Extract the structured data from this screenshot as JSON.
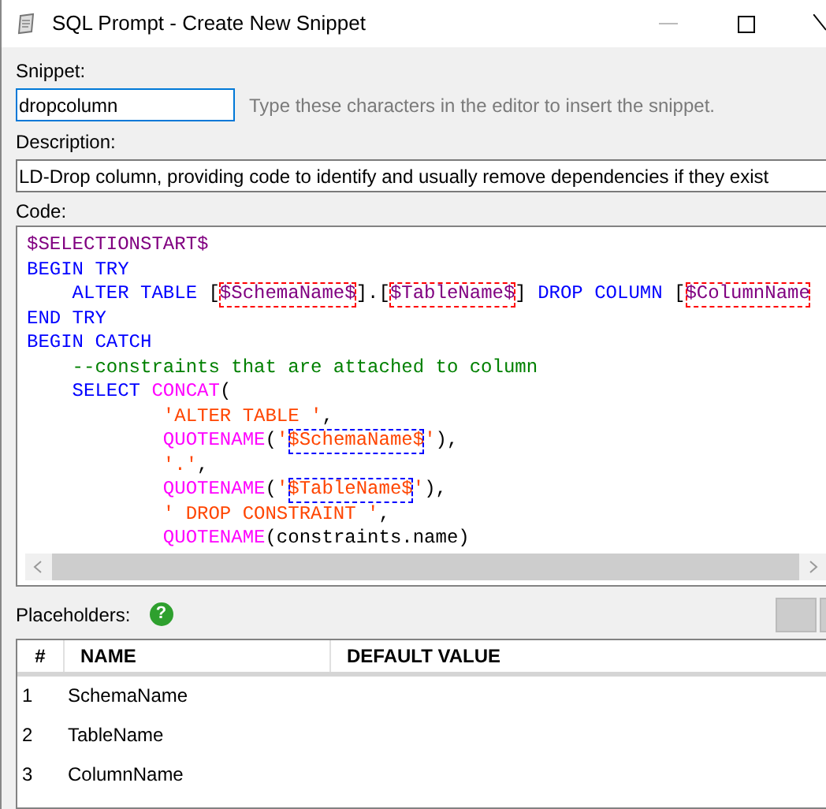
{
  "window": {
    "title": "SQL Prompt - Create New Snippet"
  },
  "snippet": {
    "label": "Snippet:",
    "value": "dropcolumn",
    "focused": true,
    "hint": "Type these characters in the editor to insert the snippet."
  },
  "description": {
    "label": "Description:",
    "value": "LD-Drop column, providing code to identify and usually remove dependencies if they exist"
  },
  "code": {
    "label": "Code:",
    "lines": [
      [
        {
          "kind": "variable",
          "text": "$SELECTIONSTART$"
        }
      ],
      [
        {
          "kind": "keyword",
          "text": "BEGIN TRY"
        }
      ],
      [
        {
          "kind": "keyword",
          "text": "    ALTER TABLE "
        },
        {
          "kind": "plain",
          "text": "["
        },
        {
          "kind": "placeholder",
          "text": "$SchemaName$"
        },
        {
          "kind": "plain",
          "text": "].["
        },
        {
          "kind": "placeholder",
          "text": "$TableName$"
        },
        {
          "kind": "plain",
          "text": "] "
        },
        {
          "kind": "keyword",
          "text": "DROP COLUMN "
        },
        {
          "kind": "plain",
          "text": "["
        },
        {
          "kind": "placeholder",
          "text": "$ColumnName"
        }
      ],
      [
        {
          "kind": "keyword",
          "text": "END TRY"
        }
      ],
      [
        {
          "kind": "keyword",
          "text": "BEGIN CATCH"
        }
      ],
      [
        {
          "kind": "comment",
          "text": "    --constraints that are attached to column"
        }
      ],
      [
        {
          "kind": "keyword",
          "text": "    SELECT "
        },
        {
          "kind": "function",
          "text": "CONCAT"
        },
        {
          "kind": "plain",
          "text": "("
        }
      ],
      [
        {
          "kind": "string",
          "text": "            'ALTER TABLE '"
        },
        {
          "kind": "plain",
          "text": ","
        }
      ],
      [
        {
          "kind": "function",
          "text": "            QUOTENAME"
        },
        {
          "kind": "plain",
          "text": "("
        },
        {
          "kind": "string",
          "text": "'"
        },
        {
          "kind": "string_placeholder",
          "text": "$SchemaName$"
        },
        {
          "kind": "string",
          "text": "'"
        },
        {
          "kind": "plain",
          "text": "),"
        }
      ],
      [
        {
          "kind": "string",
          "text": "            '.'"
        },
        {
          "kind": "plain",
          "text": ","
        }
      ],
      [
        {
          "kind": "function",
          "text": "            QUOTENAME"
        },
        {
          "kind": "plain",
          "text": "("
        },
        {
          "kind": "string",
          "text": "'"
        },
        {
          "kind": "string_placeholder",
          "text": "$TableName$"
        },
        {
          "kind": "string",
          "text": "'"
        },
        {
          "kind": "plain",
          "text": "),"
        }
      ],
      [
        {
          "kind": "string",
          "text": "            ' DROP CONSTRAINT '"
        },
        {
          "kind": "plain",
          "text": ","
        }
      ],
      [
        {
          "kind": "function",
          "text": "            QUOTENAME"
        },
        {
          "kind": "plain",
          "text": "(constraints.name)"
        }
      ]
    ]
  },
  "placeholders": {
    "label": "Placeholders:",
    "help": "?",
    "columns": [
      "#",
      "NAME",
      "DEFAULT VALUE"
    ],
    "rows": [
      {
        "number": "1",
        "name": "SchemaName"
      },
      {
        "number": "2",
        "name": "TableName"
      },
      {
        "number": "3",
        "name": "ColumnName"
      }
    ]
  }
}
